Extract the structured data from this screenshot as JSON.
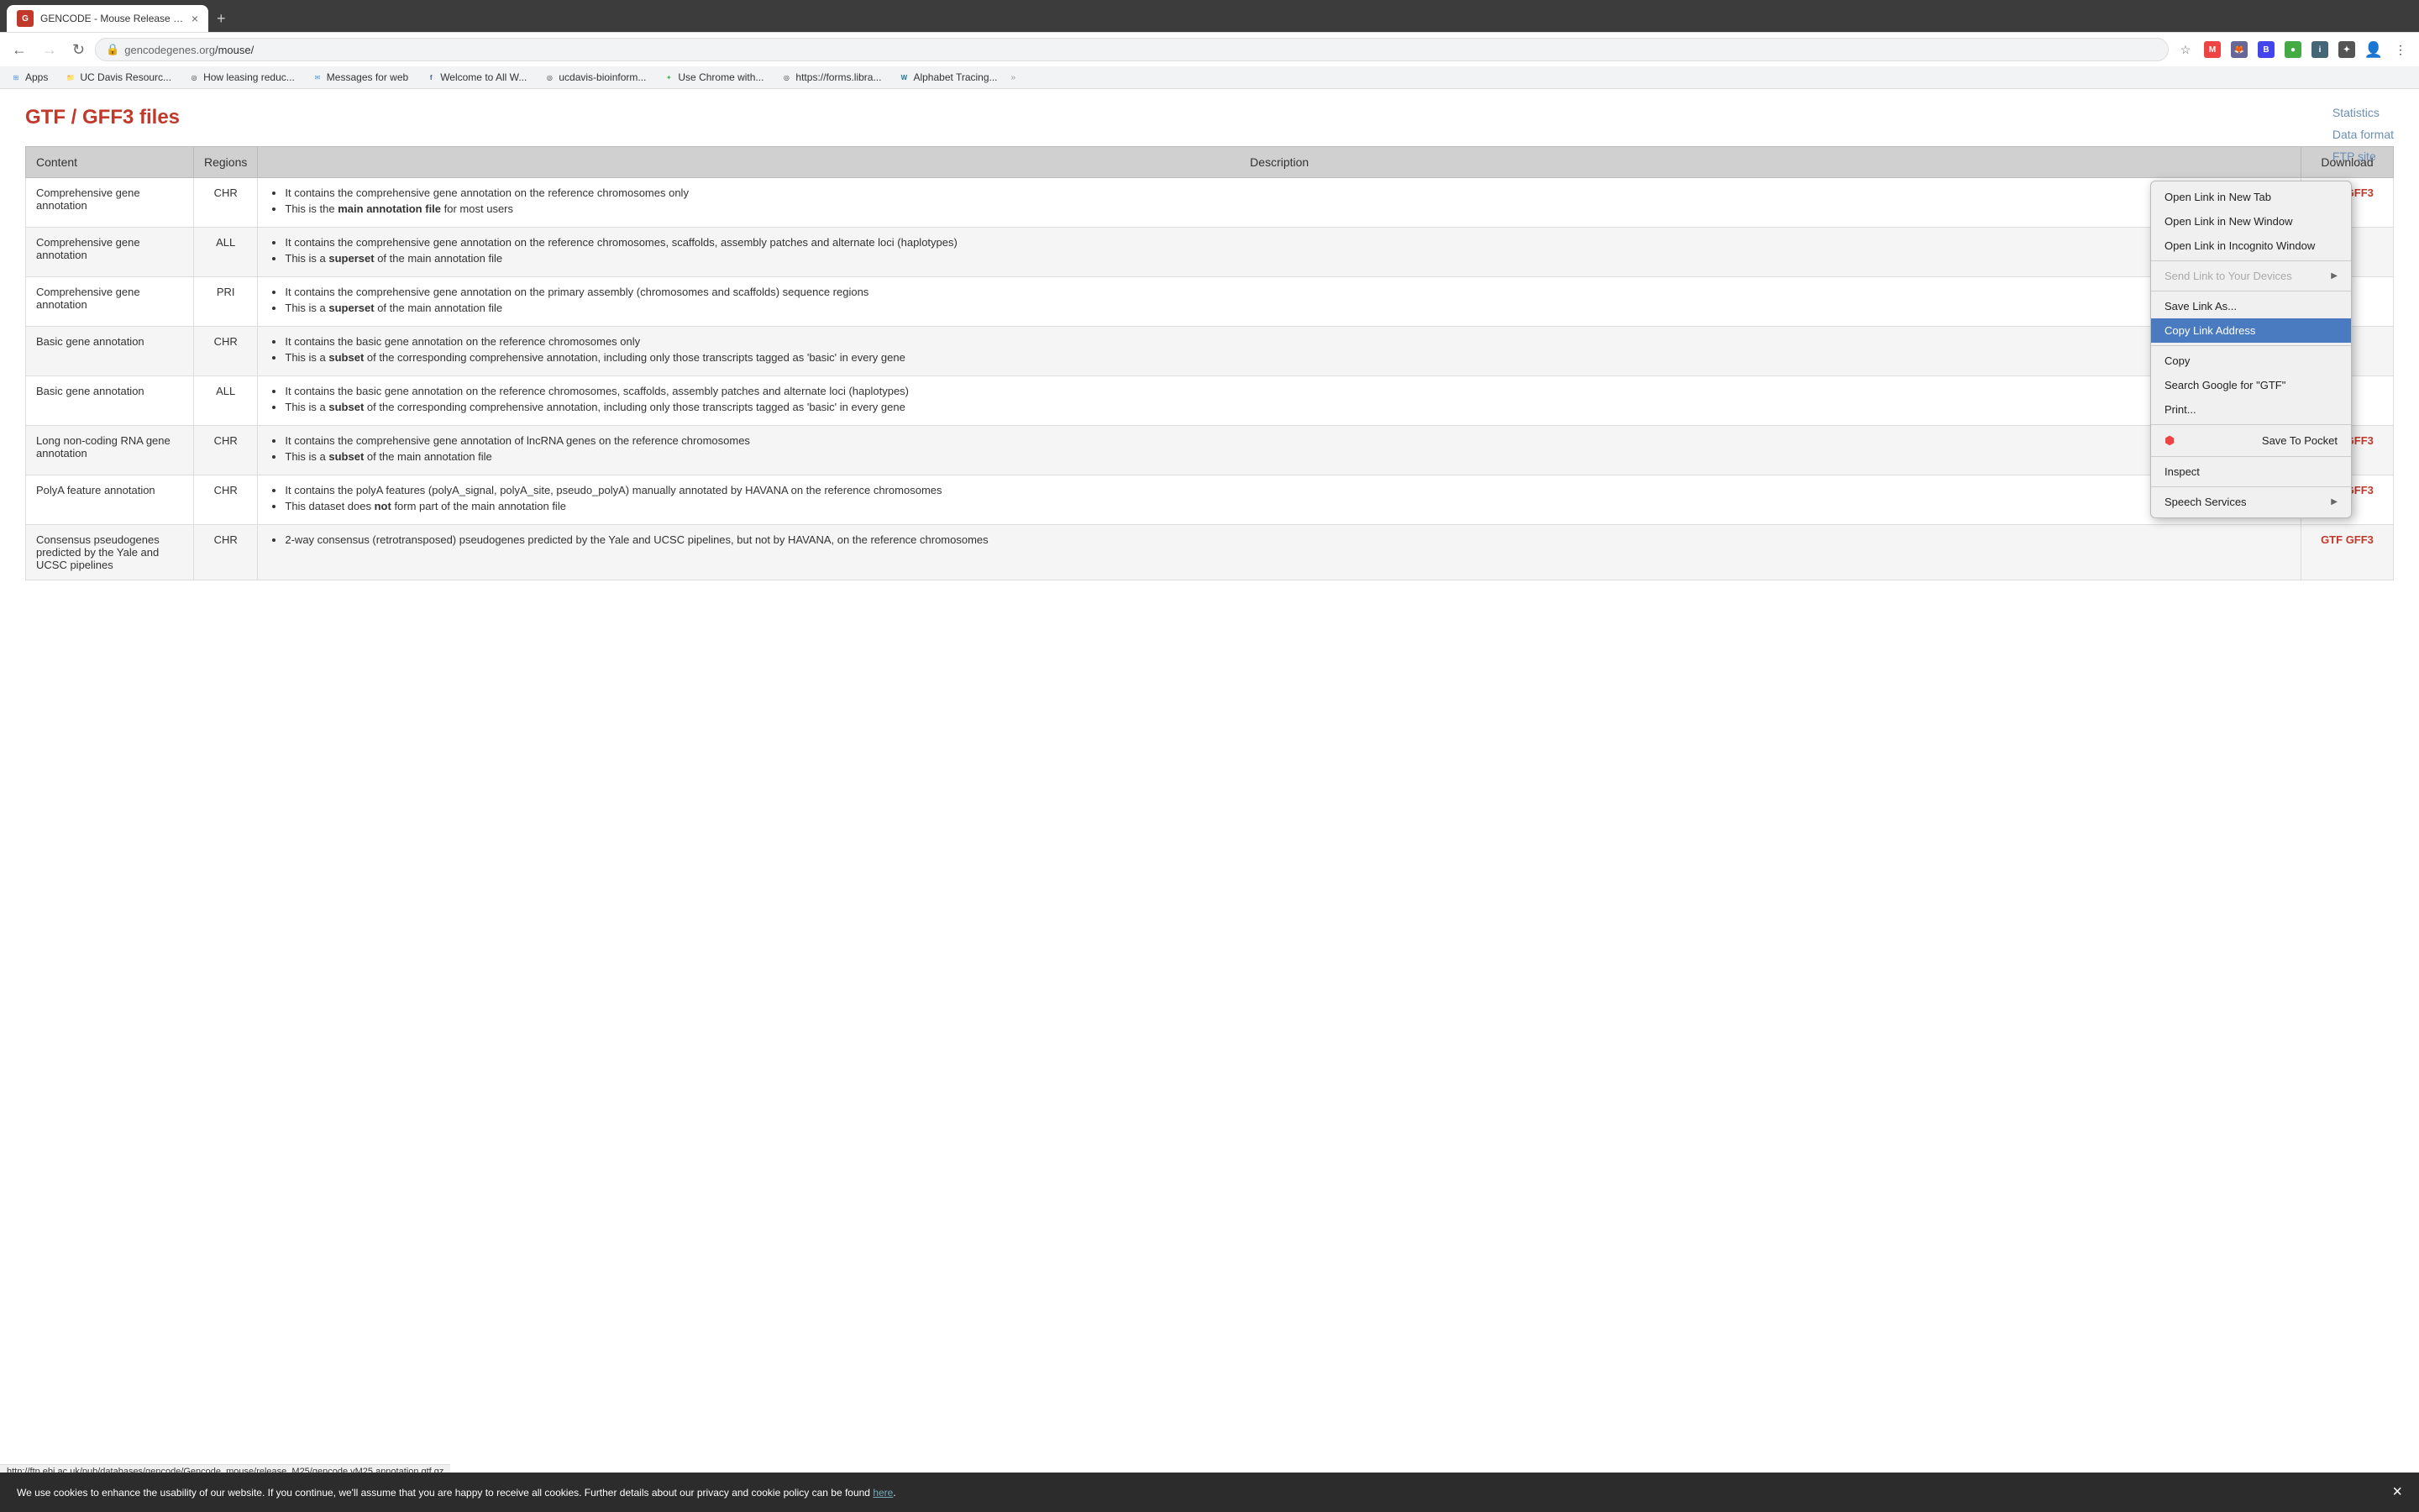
{
  "browser": {
    "tab": {
      "title": "GENCODE - Mouse Release M...",
      "favicon": "G",
      "favicon_bg": "#c0392b"
    },
    "address": {
      "protocol": "",
      "lock": "🔒",
      "url_base": "gencodegenes.org",
      "url_path": "/mouse/"
    },
    "bookmarks": [
      {
        "label": "Apps",
        "icon": "⊞",
        "type": "apps"
      },
      {
        "label": "UC Davis Resourc...",
        "icon": "📁",
        "type": "folder"
      },
      {
        "label": "How leasing reduc...",
        "icon": "◎",
        "type": "site"
      },
      {
        "label": "Messages for web",
        "icon": "✉",
        "type": "messages"
      },
      {
        "label": "Welcome to All W...",
        "icon": "f",
        "type": "fb"
      },
      {
        "label": "ucdavis-bioinform...",
        "icon": "u",
        "type": "site"
      },
      {
        "label": "Use Chrome with...",
        "icon": "✦",
        "type": "site"
      },
      {
        "label": "https://forms.libra...",
        "icon": "◎",
        "type": "site"
      },
      {
        "label": "Alphabet Tracing...",
        "icon": "W",
        "type": "wp"
      }
    ]
  },
  "page": {
    "title": "GTF / GFF3 files",
    "sidebar_links": [
      "Statistics",
      "Data format",
      "FTP site"
    ]
  },
  "table": {
    "headers": [
      "Content",
      "Regions",
      "Description",
      "Download"
    ],
    "rows": [
      {
        "content": "Comprehensive gene annotation",
        "region": "CHR",
        "description": [
          "It contains the comprehensive gene annotation on the reference chromosomes only",
          "This is the main annotation file for most users"
        ],
        "has_bold": [
          false,
          true
        ],
        "bold_parts": [
          null,
          "main annotation file"
        ],
        "download": "GTF GFF3",
        "download_red": true,
        "row_shade": false
      },
      {
        "content": "Comprehensive gene annotation",
        "region": "ALL",
        "description": [
          "It contains the comprehensive gene annotation on the reference chromosomes, scaffolds, assembly patches and alternate loci (haplotypes)",
          "This is a superset of the main annotation file"
        ],
        "bold_words": [
          "superset"
        ],
        "download": "",
        "download_red": false,
        "row_shade": true
      },
      {
        "content": "Comprehensive gene annotation",
        "region": "PRI",
        "description": [
          "It contains the comprehensive gene annotation on the primary assembly (chromosomes and scaffolds) sequence regions",
          "This is a superset of the main annotation file"
        ],
        "bold_words": [
          "superset"
        ],
        "download": "",
        "download_red": false,
        "row_shade": false
      },
      {
        "content": "Basic gene annotation",
        "region": "CHR",
        "description": [
          "It contains the basic gene annotation on the reference chromosomes only",
          "This is a subset of the corresponding comprehensive annotation, including only those transcripts tagged as 'basic' in every gene"
        ],
        "bold_words": [
          "subset"
        ],
        "download": "",
        "download_red": false,
        "row_shade": true
      },
      {
        "content": "Basic gene annotation",
        "region": "ALL",
        "description": [
          "It contains the basic gene annotation on the reference chromosomes, scaffolds, assembly patches and alternate loci (haplotypes)",
          "This is a subset of the corresponding comprehensive annotation, including only those transcripts tagged as 'basic' in every gene"
        ],
        "bold_words": [
          "subset"
        ],
        "download": "",
        "download_red": false,
        "row_shade": false
      },
      {
        "content": "Long non-coding RNA gene annotation",
        "region": "CHR",
        "description": [
          "It contains the comprehensive gene annotation of lncRNA genes on the reference chromosomes",
          "This is a subset of the main annotation file"
        ],
        "bold_words": [
          "subset"
        ],
        "download": "GTF GFF3",
        "download_red": true,
        "row_shade": true
      },
      {
        "content": "PolyA feature annotation",
        "region": "CHR",
        "description": [
          "It contains the polyA features (polyA_signal, polyA_site, pseudo_polyA) manually annotated by HAVANA on the reference chromosomes",
          "This dataset does not form part of the main annotation file"
        ],
        "bold_words": [
          "not"
        ],
        "download": "GTF GFF3",
        "download_red": true,
        "row_shade": false
      },
      {
        "content": "Consensus pseudogenes predicted by the Yale and UCSC pipelines",
        "region": "CHR",
        "description": [
          "2-way consensus (retrotransposed) pseudogenes predicted by the Yale and UCSC pipelines, but not by HAVANA, on the reference chromosomes"
        ],
        "bold_words": [],
        "download": "GTF GFF3",
        "download_red": true,
        "row_shade": true
      }
    ]
  },
  "context_menu": {
    "items": [
      {
        "label": "Open Link in New Tab",
        "type": "normal",
        "has_arrow": false
      },
      {
        "label": "Open Link in New Window",
        "type": "normal",
        "has_arrow": false
      },
      {
        "label": "Open Link in Incognito Window",
        "type": "normal",
        "has_arrow": false
      },
      {
        "type": "separator"
      },
      {
        "label": "Send Link to Your Devices",
        "type": "disabled",
        "has_arrow": true
      },
      {
        "type": "separator"
      },
      {
        "label": "Save Link As...",
        "type": "normal",
        "has_arrow": false
      },
      {
        "label": "Copy Link Address",
        "type": "highlighted",
        "has_arrow": false
      },
      {
        "type": "separator"
      },
      {
        "label": "Copy",
        "type": "normal",
        "has_arrow": false
      },
      {
        "label": "Search Google for \"GTF\"",
        "type": "normal",
        "has_arrow": false
      },
      {
        "label": "Print...",
        "type": "normal",
        "has_arrow": false
      },
      {
        "type": "separator"
      },
      {
        "label": "Save To Pocket",
        "type": "normal",
        "has_pocket": true,
        "has_arrow": false
      },
      {
        "type": "separator"
      },
      {
        "label": "Inspect",
        "type": "normal",
        "has_arrow": false
      },
      {
        "type": "separator"
      },
      {
        "label": "Speech Services",
        "type": "normal",
        "has_arrow": true
      }
    ]
  },
  "cookie_banner": {
    "text": "We use cookies to enhance the usability of our website. If you continue, we'll assume that you are happy to receive all cookies. Further details about our privacy and cookie policy can be found",
    "link_text": "here",
    "close": "×"
  },
  "status_bar": {
    "text": "http://ftp.ebi.ac.uk/pub/databases/gencode/Gencode_mouse/release_M25/gencode.vM25.annotation.gtf.gz"
  }
}
